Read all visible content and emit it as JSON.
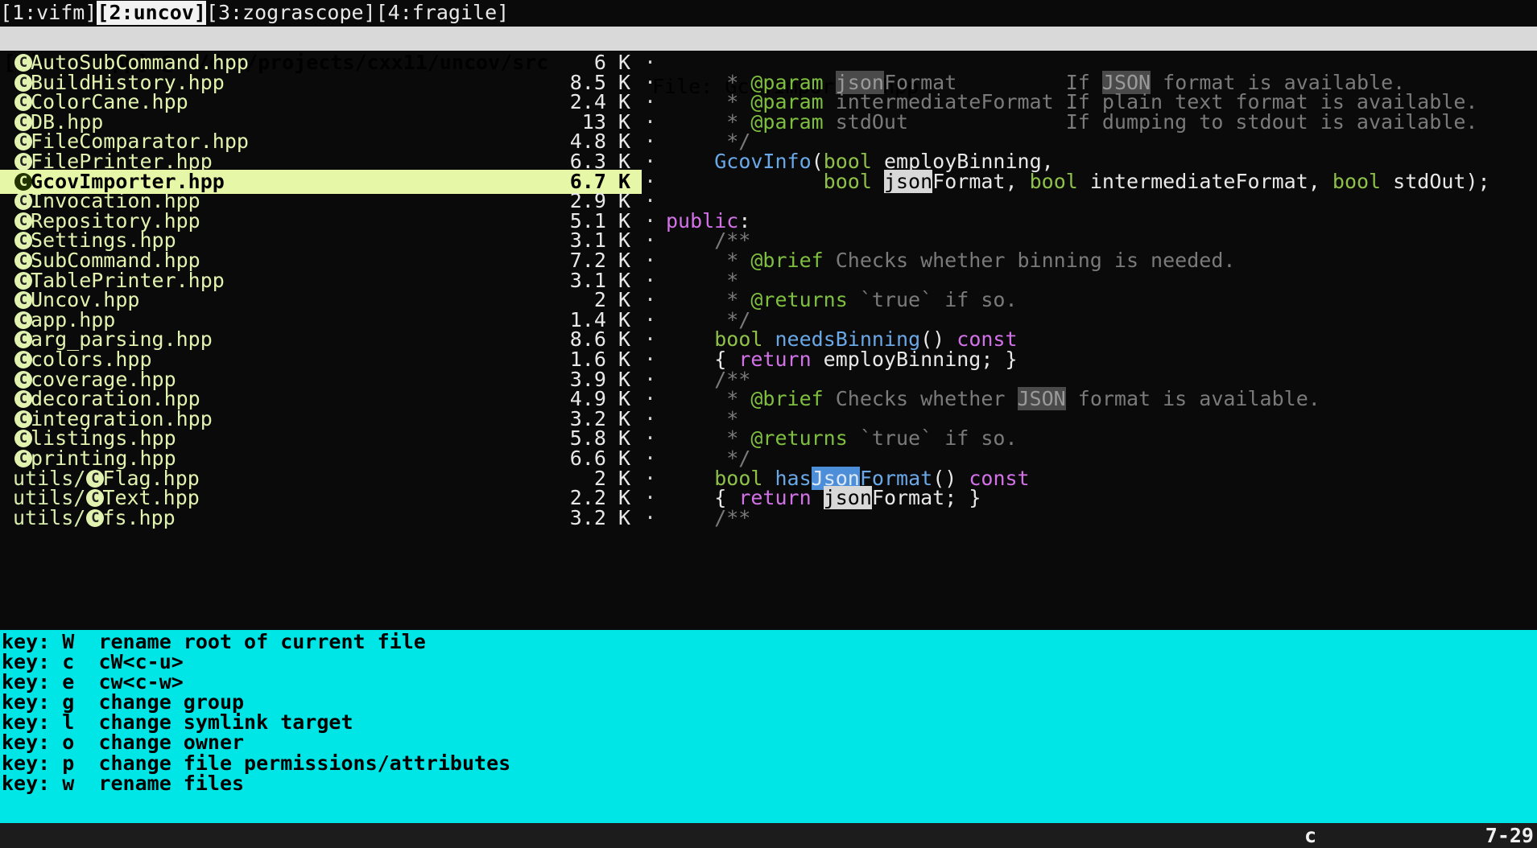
{
  "tabs": [
    {
      "label": "[1:vifm]",
      "active": false
    },
    {
      "label": "[2:uncov]",
      "active": true
    },
    {
      "label": "[3:zograscope]",
      "active": false
    },
    {
      "label": "[4:fragile]",
      "active": false
    }
  ],
  "title": {
    "path": "[Find *.hpp] @ ~/dev/projects/cxx11/uncov/src",
    "file": "File: GcovImporter.hpp"
  },
  "files": [
    {
      "prefix": "",
      "name": "AutoSubCommand.hpp",
      "size": "6 K",
      "selected": false
    },
    {
      "prefix": "",
      "name": "BuildHistory.hpp",
      "size": "8.5 K",
      "selected": false
    },
    {
      "prefix": "",
      "name": "ColorCane.hpp",
      "size": "2.4 K",
      "selected": false
    },
    {
      "prefix": "",
      "name": "DB.hpp",
      "size": "13 K",
      "selected": false
    },
    {
      "prefix": "",
      "name": "FileComparator.hpp",
      "size": "4.8 K",
      "selected": false
    },
    {
      "prefix": "",
      "name": "FilePrinter.hpp",
      "size": "6.3 K",
      "selected": false
    },
    {
      "prefix": "",
      "name": "GcovImporter.hpp",
      "size": "6.7 K",
      "selected": true
    },
    {
      "prefix": "",
      "name": "Invocation.hpp",
      "size": "2.9 K",
      "selected": false
    },
    {
      "prefix": "",
      "name": "Repository.hpp",
      "size": "5.1 K",
      "selected": false
    },
    {
      "prefix": "",
      "name": "Settings.hpp",
      "size": "3.1 K",
      "selected": false
    },
    {
      "prefix": "",
      "name": "SubCommand.hpp",
      "size": "7.2 K",
      "selected": false
    },
    {
      "prefix": "",
      "name": "TablePrinter.hpp",
      "size": "3.1 K",
      "selected": false
    },
    {
      "prefix": "",
      "name": "Uncov.hpp",
      "size": "2 K",
      "selected": false
    },
    {
      "prefix": "",
      "name": "app.hpp",
      "size": "1.4 K",
      "selected": false
    },
    {
      "prefix": "",
      "name": "arg_parsing.hpp",
      "size": "8.6 K",
      "selected": false
    },
    {
      "prefix": "",
      "name": "colors.hpp",
      "size": "1.6 K",
      "selected": false
    },
    {
      "prefix": "",
      "name": "coverage.hpp",
      "size": "3.9 K",
      "selected": false
    },
    {
      "prefix": "",
      "name": "decoration.hpp",
      "size": "4.9 K",
      "selected": false
    },
    {
      "prefix": "",
      "name": "integration.hpp",
      "size": "3.2 K",
      "selected": false
    },
    {
      "prefix": "",
      "name": "listings.hpp",
      "size": "5.8 K",
      "selected": false
    },
    {
      "prefix": "",
      "name": "printing.hpp",
      "size": "6.6 K",
      "selected": false
    },
    {
      "prefix": "utils/",
      "name": "Flag.hpp",
      "size": "2 K",
      "selected": false
    },
    {
      "prefix": "utils/",
      "name": "Text.hpp",
      "size": "2.2 K",
      "selected": false
    },
    {
      "prefix": "utils/",
      "name": "fs.hpp",
      "size": "3.2 K",
      "selected": false
    }
  ],
  "preview": [
    [],
    [
      [
        "cm",
        "     * "
      ],
      [
        "tag",
        "@param"
      ],
      [
        "cm",
        " "
      ],
      [
        "hl-dark",
        "json"
      ],
      [
        "cm",
        "Format         If "
      ],
      [
        "hl-dark",
        "JSON"
      ],
      [
        "cm",
        " format is available."
      ]
    ],
    [
      [
        "cm",
        "     * "
      ],
      [
        "tag",
        "@param"
      ],
      [
        "cm",
        " intermediateFormat If plain text format is available."
      ]
    ],
    [
      [
        "cm",
        "     * "
      ],
      [
        "tag",
        "@param"
      ],
      [
        "cm",
        " stdOut             If dumping to stdout is available."
      ]
    ],
    [
      [
        "cm",
        "     */"
      ]
    ],
    [
      [
        "tx",
        "    "
      ],
      [
        "fn",
        "GcovInfo"
      ],
      [
        "tx",
        "("
      ],
      [
        "ty",
        "bool"
      ],
      [
        "tx",
        " employBinning,"
      ]
    ],
    [
      [
        "tx",
        "             "
      ],
      [
        "ty",
        "bool"
      ],
      [
        "tx",
        " "
      ],
      [
        "hl-light",
        "json"
      ],
      [
        "tx",
        "Format, "
      ],
      [
        "ty",
        "bool"
      ],
      [
        "tx",
        " intermediateFormat, "
      ],
      [
        "ty",
        "bool"
      ],
      [
        "tx",
        " stdOut);"
      ]
    ],
    [],
    [
      [
        "kw",
        "public"
      ],
      [
        "tx",
        ":"
      ]
    ],
    [
      [
        "cm",
        "    /**"
      ]
    ],
    [
      [
        "cm",
        "     * "
      ],
      [
        "tag",
        "@brief"
      ],
      [
        "cm",
        " Checks whether binning is needed."
      ]
    ],
    [
      [
        "cm",
        "     *"
      ]
    ],
    [
      [
        "cm",
        "     * "
      ],
      [
        "tag",
        "@returns"
      ],
      [
        "cm",
        " `true` if so."
      ]
    ],
    [
      [
        "cm",
        "     */"
      ]
    ],
    [
      [
        "tx",
        "    "
      ],
      [
        "ty",
        "bool"
      ],
      [
        "tx",
        " "
      ],
      [
        "fn",
        "needsBinning"
      ],
      [
        "tx",
        "() "
      ],
      [
        "kw",
        "const"
      ]
    ],
    [
      [
        "tx",
        "    { "
      ],
      [
        "kw",
        "return"
      ],
      [
        "tx",
        " employBinning; }"
      ]
    ],
    [
      [
        "cm",
        "    /**"
      ]
    ],
    [
      [
        "cm",
        "     * "
      ],
      [
        "tag",
        "@brief"
      ],
      [
        "cm",
        " Checks whether "
      ],
      [
        "hl-dark",
        "JSON"
      ],
      [
        "cm",
        " format is available."
      ]
    ],
    [
      [
        "cm",
        "     *"
      ]
    ],
    [
      [
        "cm",
        "     * "
      ],
      [
        "tag",
        "@returns"
      ],
      [
        "cm",
        " `true` if so."
      ]
    ],
    [
      [
        "cm",
        "     */"
      ]
    ],
    [
      [
        "tx",
        "    "
      ],
      [
        "ty",
        "bool"
      ],
      [
        "tx",
        " "
      ],
      [
        "fn",
        "has"
      ],
      [
        "hl-blue",
        "Json"
      ],
      [
        "fn",
        "Format"
      ],
      [
        "tx",
        "() "
      ],
      [
        "kw",
        "const"
      ]
    ],
    [
      [
        "tx",
        "    { "
      ],
      [
        "kw",
        "return"
      ],
      [
        "tx",
        " "
      ],
      [
        "hl-light",
        "json"
      ],
      [
        "tx",
        "Format; }"
      ]
    ],
    [
      [
        "cm",
        "    /**"
      ]
    ]
  ],
  "keys": [
    {
      "key": "W",
      "desc": "rename root of current file"
    },
    {
      "key": "c",
      "desc": "cW<c-u>"
    },
    {
      "key": "e",
      "desc": "cw<c-w>"
    },
    {
      "key": "g",
      "desc": "change group"
    },
    {
      "key": "l",
      "desc": "change symlink target"
    },
    {
      "key": "o",
      "desc": "change owner"
    },
    {
      "key": "p",
      "desc": "change file permissions/attributes"
    },
    {
      "key": "w",
      "desc": "rename files"
    }
  ],
  "key_prefix": "key: ",
  "separator_glyph": "·",
  "status": {
    "command": "c",
    "position": "7-29"
  }
}
